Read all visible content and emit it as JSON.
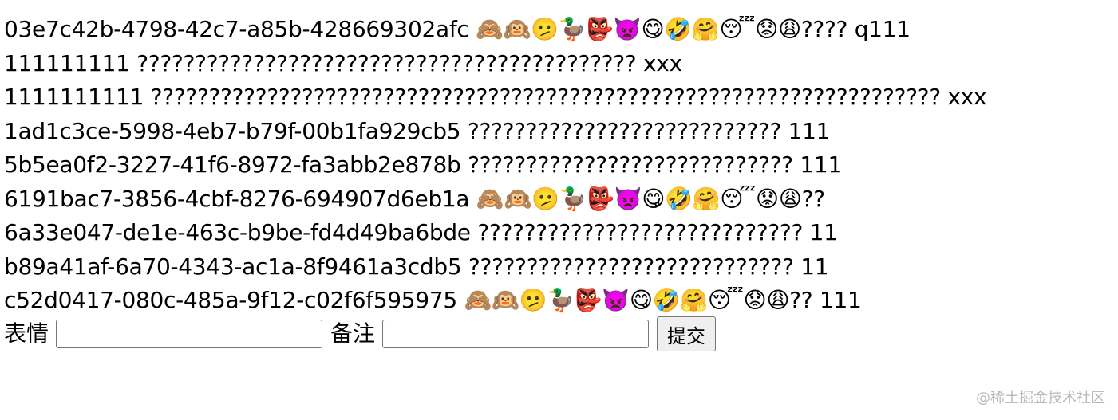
{
  "records": [
    "03e7c42b-4798-42c7-a85b-428669302afc 🙈🙉🫤🦆👺👿😋🤣🤗😴😟😩???? q111",
    "111111111 ??????????????????????????????????????????? xxx",
    "1111111111 ???????????????????????????????????????????????????????????????????? xxx",
    "1ad1c3ce-5998-4eb7-b79f-00b1fa929cb5 ??????????????????????????? 111",
    "5b5ea0f2-3227-41f6-8972-fa3abb2e878b ???????????????????????????? 111",
    "6191bac7-3856-4cbf-8276-694907d6eb1a 🙈🙉🫤🦆👺👿😋🤣🤗😴😟😩??",
    "6a33e047-de1e-463c-b9be-fd4d49ba6bde ???????????????????????????? 11",
    "b89a41af-6a70-4343-ac1a-8f9461a3cdb5 ???????????????????????????? 11",
    "c52d0417-080c-485a-9f12-c02f6f595975 🙈🙉🫤🦆👺👿😋🤣🤗😴😟😩?? 111"
  ],
  "form": {
    "emoji_label": "表情",
    "emoji_value": "",
    "note_label": "备注",
    "note_value": "",
    "submit_label": "提交"
  },
  "watermark": "@稀土掘金技术社区"
}
